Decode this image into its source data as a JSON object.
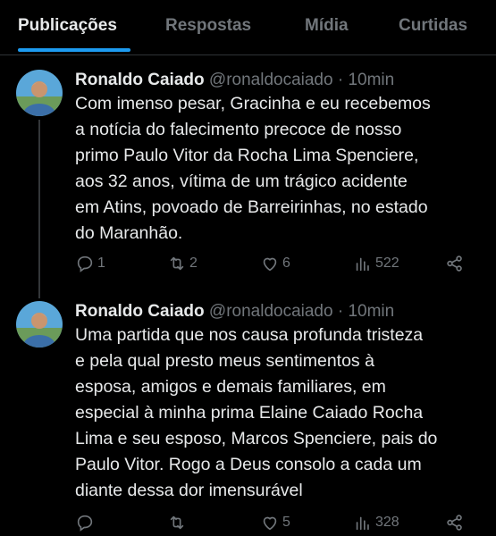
{
  "tabs": [
    {
      "label": "Publicações"
    },
    {
      "label": "Respostas"
    },
    {
      "label": "Mídia"
    },
    {
      "label": "Curtidas"
    }
  ],
  "posts": [
    {
      "name": "Ronaldo Caiado",
      "handle": "@ronaldocaiado",
      "separator": "·",
      "time": "10min",
      "lines": [
        "Com imenso pesar, Gracinha e eu recebemos",
        "a notícia do falecimento precoce de nosso",
        "primo Paulo Vitor da Rocha Lima Spenciere,",
        "aos 32 anos, vítima de um trágico acidente",
        "em Atins, povoado de Barreirinhas, no estado",
        "do Maranhão."
      ],
      "replies": "1",
      "reposts": "2",
      "likes": "6",
      "views": "522"
    },
    {
      "name": "Ronaldo Caiado",
      "handle": "@ronaldocaiado",
      "separator": "·",
      "time": "10min",
      "lines": [
        "Uma partida que nos causa profunda tristeza",
        "e pela qual presto meus sentimentos à",
        "esposa, amigos e demais familiares, em",
        "especial à minha prima Elaine Caiado Rocha",
        "Lima e seu esposo, Marcos Spenciere, pais do",
        "Paulo Vitor. Rogo a Deus consolo a cada um",
        "diante dessa dor imensurável"
      ],
      "replies": "",
      "reposts": "",
      "likes": "5",
      "views": "328"
    }
  ],
  "icons": {
    "reply": "reply-icon",
    "repost": "repost-icon",
    "like": "like-icon",
    "views": "views-icon",
    "share": "share-icon"
  },
  "colors": {
    "background": "#000000",
    "text": "#e7e9ea",
    "muted": "#71767b",
    "accent": "#1d9bf0"
  }
}
